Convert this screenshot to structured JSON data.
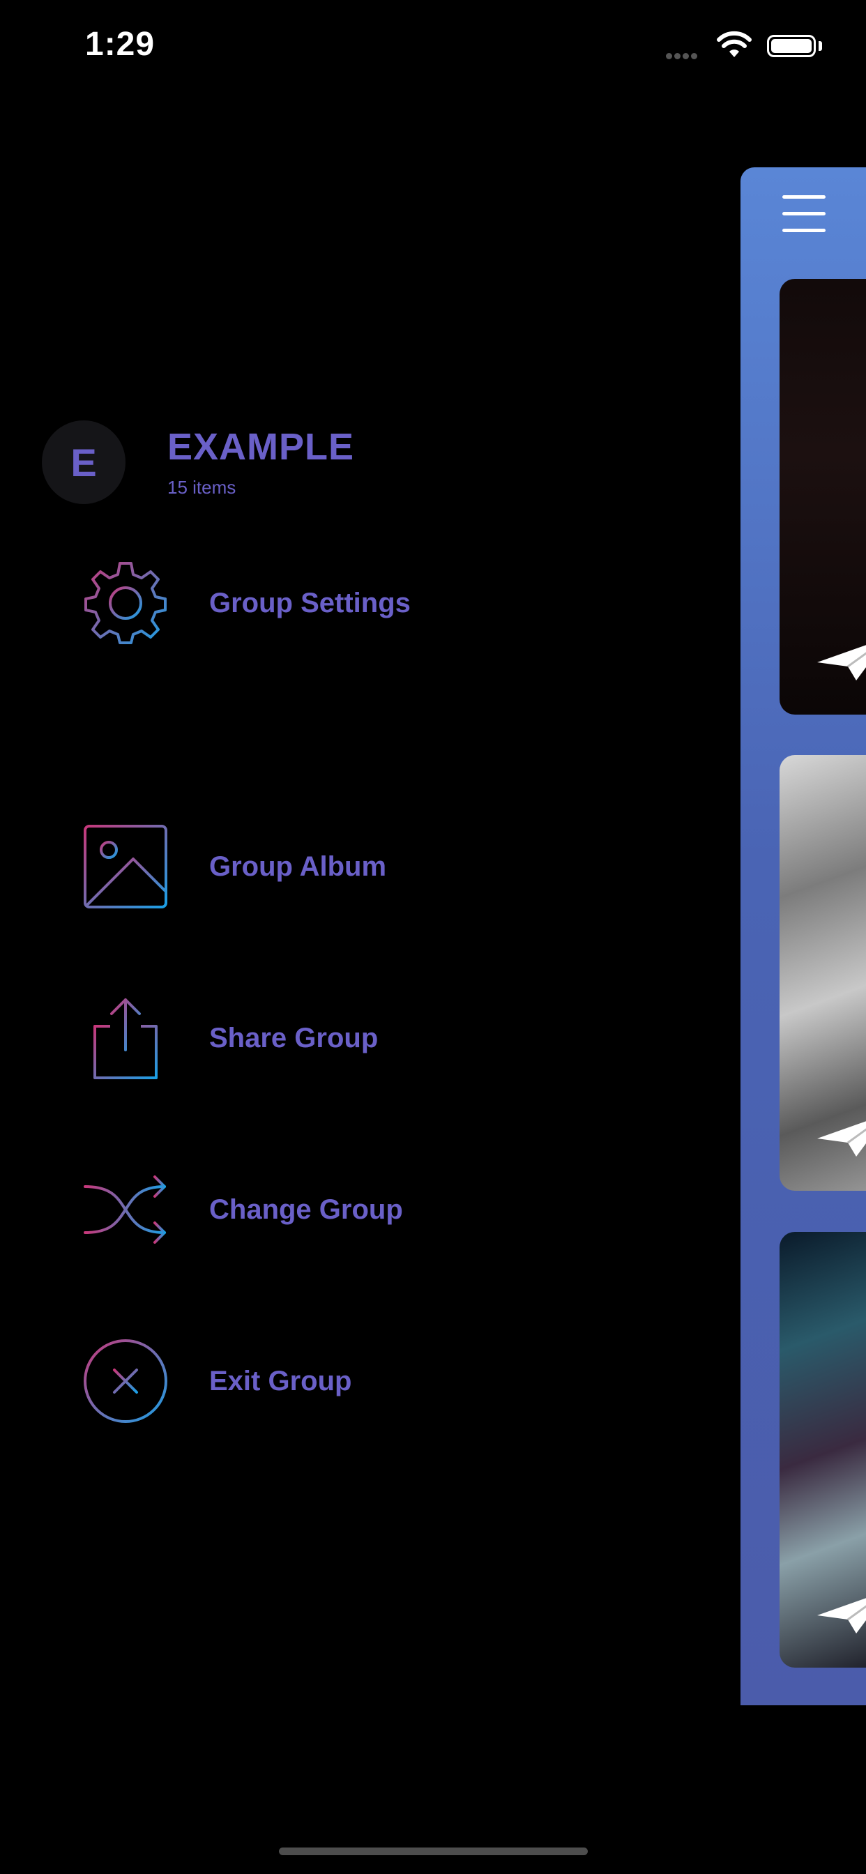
{
  "status_bar": {
    "time": "1:29"
  },
  "drawer": {
    "avatar_initial": "E",
    "group_name": "EXAMPLE",
    "group_count": "15 items",
    "menu": [
      {
        "label": "Group Settings",
        "icon": "gear-icon"
      },
      {
        "label": "Group Album",
        "icon": "image-icon"
      },
      {
        "label": "Share Group",
        "icon": "share-icon"
      },
      {
        "label": "Change Group",
        "icon": "shuffle-icon"
      },
      {
        "label": "Exit Group",
        "icon": "close-circle-icon"
      }
    ]
  },
  "colors": {
    "accent": "#6a60c8",
    "icon_gradient_start": "#c7387a",
    "icon_gradient_end": "#1aa0e6",
    "panel_top": "#5a86d6",
    "panel_bottom": "#4b5cab"
  },
  "main_panel": {
    "menu_icon": "hamburger-icon",
    "cards": [
      {
        "name": "feed-card-1",
        "action_icon": "paper-plane-icon"
      },
      {
        "name": "feed-card-2",
        "action_icon": "paper-plane-icon"
      },
      {
        "name": "feed-card-3",
        "action_icon": "paper-plane-icon"
      }
    ]
  }
}
